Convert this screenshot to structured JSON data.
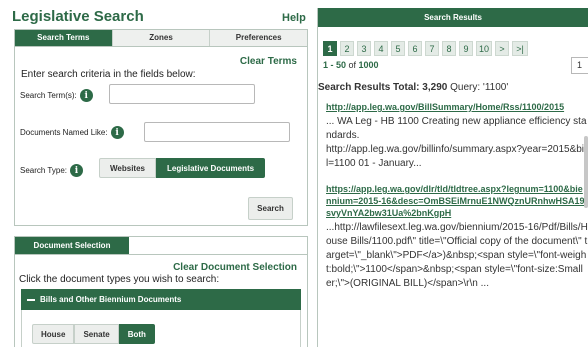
{
  "header": {
    "title": "Legislative Search",
    "help_label": "Help"
  },
  "search_panel": {
    "tabs": [
      "Search Terms",
      "Zones",
      "Preferences"
    ],
    "active_tab": 0,
    "clear_label": "Clear Terms",
    "instructions": "Enter search criteria in the fields below:",
    "search_terms_label": "Search Term(s):",
    "search_terms_value": "",
    "documents_named_label": "Documents Named Like:",
    "documents_named_value": "",
    "search_type_label": "Search Type:",
    "search_type_options": [
      "Websites",
      "Legislative Documents"
    ],
    "search_type_selected": 1,
    "search_button_label": "Search",
    "info_glyph": "i"
  },
  "document_selection": {
    "tab_label": "Document Selection",
    "clear_label": "Clear Document Selection",
    "instructions": "Click the document types you wish to search:",
    "section_title": "Bills and Other Biennium Documents",
    "chamber_options": [
      "House",
      "Senate",
      "Both"
    ],
    "chamber_selected": 2
  },
  "results": {
    "header": "Search Results",
    "pages": [
      "1",
      "2",
      "3",
      "4",
      "5",
      "6",
      "7",
      "8",
      "9",
      "10",
      ">",
      ">|"
    ],
    "active_page": 0,
    "range_prefix": "1 - 50",
    "range_of": " of ",
    "range_total": "1000",
    "page_size_value": "1",
    "total_label": "Search Results Total:",
    "total_count": "3,290",
    "query_label": "Query:",
    "query_value": "'1100'",
    "items": [
      {
        "link": "http://app.leg.wa.gov/BillSummary/Home/Rss/1100/2015",
        "snippet": "... WA Leg - HB 1100 Creating new appliance efficiency standards.\nhttp://app.leg.wa.gov/billinfo/summary.aspx?year=2015&bill=1100 01 - January..."
      },
      {
        "link": "https://app.leg.wa.gov/dlr/tld/tldtree.aspx?legnum=1100&biennium=2015-16&desc=OmBSEiMrnuE1NWQznURnhwHSA19svyVnYA2bw31Ua%2bnKgpH",
        "snippet": "...http://lawfilesext.leg.wa.gov/biennium/2015-16/Pdf/Bills/House Bills/1100.pdf\\\" title=\\\"Official copy of the document\\\" target=\\\"_blank\\\">PDF</a>)&nbsp;<span style=\\\"font-weight:bold;\\\">1100</span>&nbsp;<span style=\\\"font-size:Smaller;\\\">(ORIGINAL BILL)</span>\\r\\n ..."
      }
    ]
  },
  "colors": {
    "brand_green": "#2d6a47",
    "panel_border": "#b8c6bd",
    "inactive_tab": "#eef0ee"
  },
  "icons": {
    "info": "info-icon",
    "collapse": "minus-icon"
  }
}
